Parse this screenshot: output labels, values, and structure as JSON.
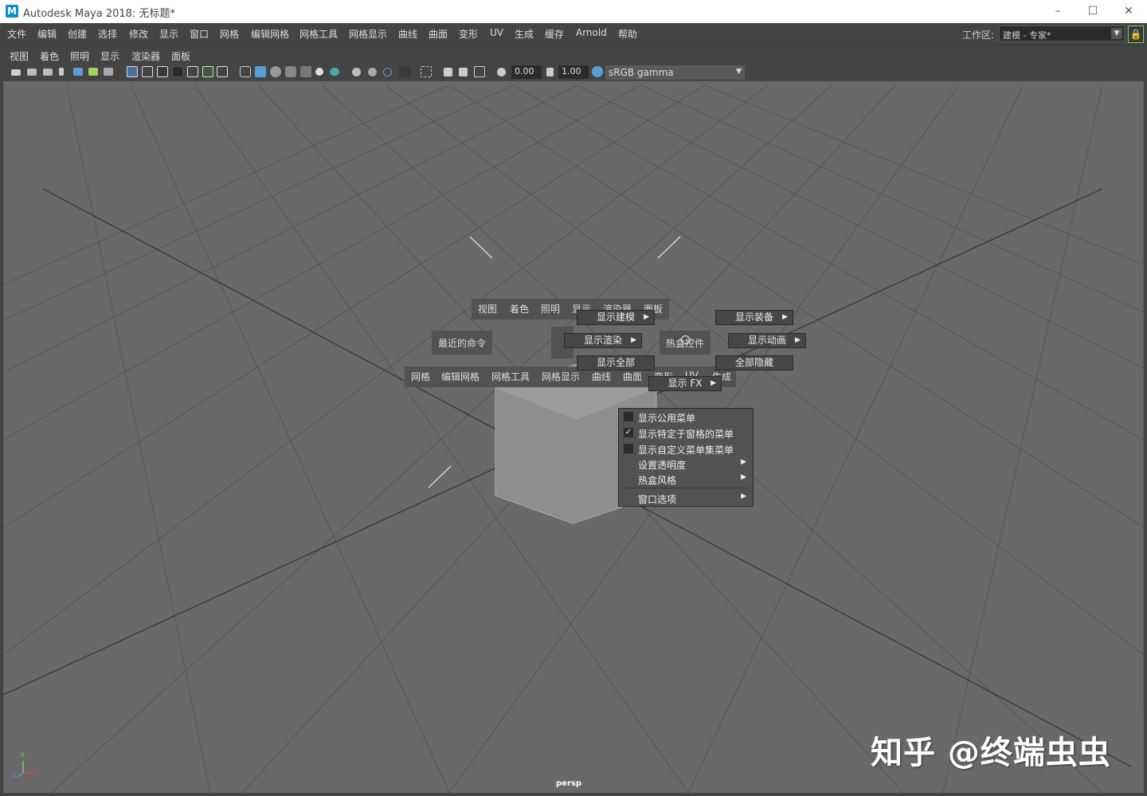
{
  "window": {
    "title": "Autodesk Maya 2018: 无标题*",
    "logo": "M",
    "minimize": "–",
    "maximize": "☐",
    "close": "✕"
  },
  "menubar": {
    "items": [
      "文件",
      "编辑",
      "创建",
      "选择",
      "修改",
      "显示",
      "窗口",
      "网格",
      "编辑网格",
      "网格工具",
      "网格显示",
      "曲线",
      "曲面",
      "变形",
      "UV",
      "生成",
      "缓存",
      "Arnold",
      "帮助"
    ],
    "workspace_label": "工作区:",
    "workspace_value": "建模 - 专家*"
  },
  "panel_menu": {
    "items": [
      "视图",
      "着色",
      "照明",
      "显示",
      "渲染器",
      "面板"
    ]
  },
  "toolbar": {
    "exposure": "0.00",
    "gamma": "1.00",
    "colorspace": "sRGB gamma"
  },
  "hotbox": {
    "top_row": [
      "视图",
      "着色",
      "照明",
      "显示",
      "渲染器",
      "面板"
    ],
    "recent": "最近的命令",
    "hotbox_controls": "热盒控件",
    "bottom_row": [
      "网格",
      "编辑网格",
      "网格工具",
      "网格显示",
      "曲线",
      "曲面",
      "变形",
      "UV",
      "生成"
    ],
    "buttons": {
      "show_modeling": "显示建模",
      "show_rigging": "显示装备",
      "show_rendering": "显示渲染",
      "show_animation": "显示动画",
      "show_all": "显示全部",
      "hide_all": "全部隐藏",
      "show_fx": "显示 FX"
    }
  },
  "context_menu": {
    "items": [
      {
        "label": "显示公用菜单",
        "checked": false
      },
      {
        "label": "显示特定于窗格的菜单",
        "checked": true
      },
      {
        "label": "显示自定义菜单集菜单",
        "checked": false
      },
      {
        "label": "设置透明度",
        "submenu": true
      },
      {
        "label": "热盒风格",
        "submenu": true
      },
      {
        "label": "窗口选项",
        "submenu": true
      }
    ]
  },
  "viewport": {
    "camera": "persp",
    "axis_x": "x",
    "axis_y": "y",
    "axis_z": "z"
  },
  "watermark": "知乎 @终端虫虫",
  "colors": {
    "viewport_bg": "#696969",
    "accent_blue": "#5a9fd4",
    "lock_green": "#6fcf5b"
  }
}
